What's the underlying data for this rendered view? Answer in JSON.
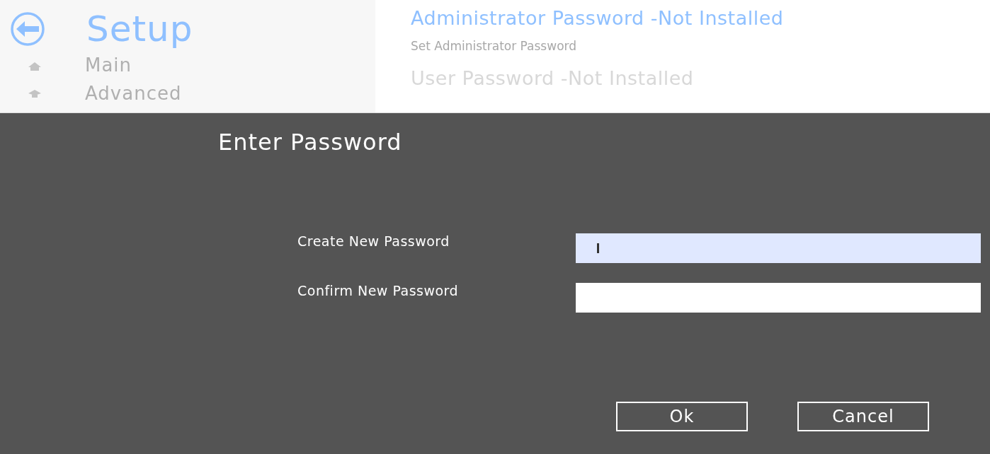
{
  "sidebar": {
    "title": "Setup",
    "items": [
      {
        "label": "Main"
      },
      {
        "label": "Advanced"
      }
    ]
  },
  "content": {
    "items": [
      {
        "label": "Administrator Password -Not Installed",
        "selected": true,
        "description": "Set Administrator Password"
      },
      {
        "label": "User Password -Not Installed",
        "selected": false
      }
    ]
  },
  "dialog": {
    "title": "Enter Password",
    "fields": [
      {
        "label": "Create New Password",
        "focused": true
      },
      {
        "label": "Confirm New Password",
        "focused": false
      }
    ],
    "buttons": [
      "Ok",
      "Cancel"
    ]
  }
}
